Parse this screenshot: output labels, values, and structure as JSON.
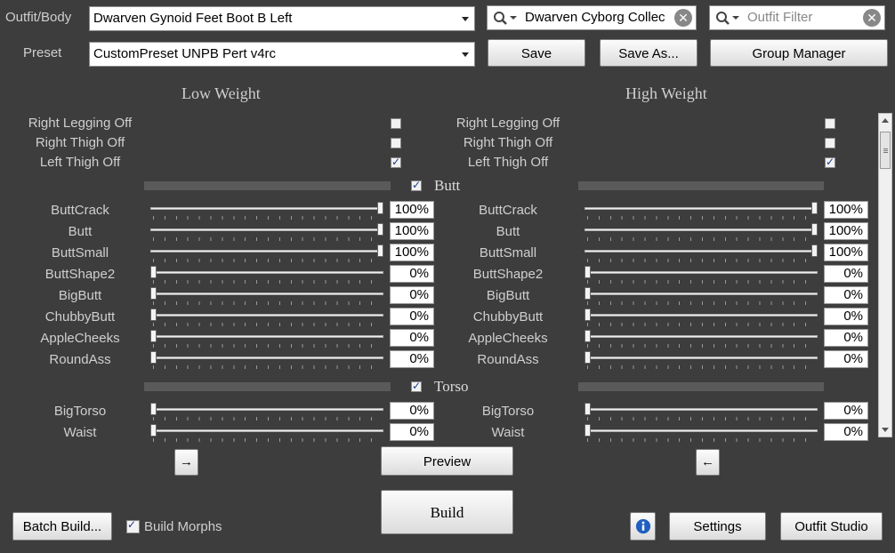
{
  "top": {
    "outfit_label": "Outfit/Body",
    "outfit_value": "Dwarven Gynoid Feet Boot B Left",
    "preset_label": "Preset",
    "preset_value": "CustomPreset UNPB Pert v4rc",
    "search_value": "Dwarven Cyborg Collec",
    "filter_placeholder": "Outfit Filter",
    "save_label": "Save",
    "save_as_label": "Save As...",
    "group_manager_label": "Group Manager"
  },
  "columns": {
    "low": "Low Weight",
    "high": "High Weight"
  },
  "toggles": [
    {
      "label": "Right Legging Off",
      "checked": false
    },
    {
      "label": "Right Thigh Off",
      "checked": false
    },
    {
      "label": "Left Thigh Off",
      "checked": true
    }
  ],
  "sections": [
    {
      "title": "Butt",
      "checked": true,
      "sliders": [
        {
          "name": "ButtCrack",
          "low": 100,
          "high": 100,
          "low_text": "100%",
          "high_text": "100%"
        },
        {
          "name": "Butt",
          "low": 100,
          "high": 100,
          "low_text": "100%",
          "high_text": "100%"
        },
        {
          "name": "ButtSmall",
          "low": 100,
          "high": 100,
          "low_text": "100%",
          "high_text": "100%"
        },
        {
          "name": "ButtShape2",
          "low": 0,
          "high": 0,
          "low_text": "0%",
          "high_text": "0%"
        },
        {
          "name": "BigButt",
          "low": 0,
          "high": 0,
          "low_text": "0%",
          "high_text": "0%"
        },
        {
          "name": "ChubbyButt",
          "low": 0,
          "high": 0,
          "low_text": "0%",
          "high_text": "0%"
        },
        {
          "name": "AppleCheeks",
          "low": 0,
          "high": 0,
          "low_text": "0%",
          "high_text": "0%"
        },
        {
          "name": "RoundAss",
          "low": 0,
          "high": 0,
          "low_text": "0%",
          "high_text": "0%"
        }
      ]
    },
    {
      "title": "Torso",
      "checked": true,
      "sliders": [
        {
          "name": "BigTorso",
          "low": 0,
          "high": 0,
          "low_text": "0%",
          "high_text": "0%"
        },
        {
          "name": "Waist",
          "low": 0,
          "high": 0,
          "low_text": "0%",
          "high_text": "0%"
        }
      ]
    }
  ],
  "bottom": {
    "copy_right_glyph": "→",
    "copy_left_glyph": "←",
    "preview_label": "Preview",
    "build_label": "Build",
    "batch_build_label": "Batch Build...",
    "build_morphs_label": "Build Morphs",
    "build_morphs_checked": true,
    "settings_label": "Settings",
    "outfit_studio_label": "Outfit Studio",
    "info_icon": "info-icon"
  },
  "colors": {
    "background": "#3d3d3d",
    "info_blue": "#1f5fbf"
  }
}
